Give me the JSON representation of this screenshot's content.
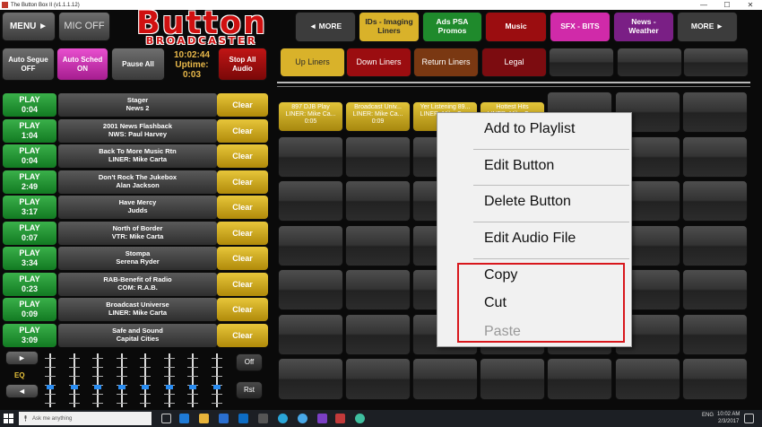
{
  "window": {
    "title": "The Button Box II (v1.1.1.12)",
    "controls": [
      "—",
      "☐",
      "✕"
    ]
  },
  "logo": {
    "line1": "Button",
    "line2": "BROADCASTER"
  },
  "top_left": {
    "menu_label": "MENU ►",
    "mic_label": "MIC OFF"
  },
  "controls": {
    "auto_segue": "Auto Segue\nOFF",
    "auto_sched": "Auto Sched\nON",
    "pause_all": "Pause All",
    "stop_all": "Stop All\nAudio"
  },
  "clock": {
    "time": "10:02:44",
    "uptime_label": "Uptime:",
    "uptime": "0:03"
  },
  "categories": [
    {
      "label": "◄ MORE",
      "color": "#3c3c3c",
      "text": "#ffffff"
    },
    {
      "label": "IDs - Imaging\nLiners",
      "color": "#d9b22a",
      "text": "#2a2a2a"
    },
    {
      "label": "Ads PSA\nPromos",
      "color": "#1f8a2c",
      "text": "#ffffff"
    },
    {
      "label": "Music",
      "color": "#9b0d10",
      "text": "#ffffff"
    },
    {
      "label": "SFX - BITS",
      "color": "#d02aa9",
      "text": "#ffffff"
    },
    {
      "label": "News -\nWeather",
      "color": "#7a1f85",
      "text": "#ffffff"
    },
    {
      "label": "MORE ►",
      "color": "#3c3c3c",
      "text": "#ffffff"
    }
  ],
  "subtabs": [
    {
      "label": "Up Liners",
      "color": "#d9b22a",
      "text": "#2a2a2a"
    },
    {
      "label": "Down Liners",
      "color": "#9b0d10",
      "text": "#ffffff"
    },
    {
      "label": "Return Liners",
      "color": "#7a3812",
      "text": "#ffffff"
    },
    {
      "label": "Legal",
      "color": "#7c0c10",
      "text": "#ffffff"
    }
  ],
  "playlist": [
    {
      "play": "PLAY",
      "time": "0:04",
      "line1": "Stager",
      "line2": "News 2",
      "clear": "Clear"
    },
    {
      "play": "PLAY",
      "time": "1:04",
      "line1": "2001 News Flashback",
      "line2": "NWS:  Paul Harvey",
      "clear": "Clear"
    },
    {
      "play": "PLAY",
      "time": "0:04",
      "line1": "Back To More Music Rtn",
      "line2": "LINER: Mike Carta",
      "clear": "Clear"
    },
    {
      "play": "PLAY",
      "time": "2:49",
      "line1": "Don't Rock The Jukebox",
      "line2": "Alan Jackson",
      "clear": "Clear"
    },
    {
      "play": "PLAY",
      "time": "3:17",
      "line1": "Have Mercy",
      "line2": "Judds",
      "clear": "Clear"
    },
    {
      "play": "PLAY",
      "time": "0:07",
      "line1": "North of Border",
      "line2": "VTR: Mike Carta",
      "clear": "Clear"
    },
    {
      "play": "PLAY",
      "time": "3:34",
      "line1": "Stompa",
      "line2": "Serena Ryder",
      "clear": "Clear"
    },
    {
      "play": "PLAY",
      "time": "0:23",
      "line1": "RAB-Benefit of Radio",
      "line2": "COM: R.A.B.",
      "clear": "Clear"
    },
    {
      "play": "PLAY",
      "time": "0:09",
      "line1": "Broadcast Universe",
      "line2": "LINER: Mike Carta",
      "clear": "Clear"
    },
    {
      "play": "PLAY",
      "time": "3:09",
      "line1": "Safe and Sound",
      "line2": "Capital Cities",
      "clear": "Clear"
    }
  ],
  "eq": {
    "next": "►",
    "label": "EQ",
    "prev": "◄",
    "off": "Off",
    "reset": "Rst"
  },
  "audio_buttons": [
    {
      "line1": "897 DJB Play",
      "line2": "LINER: Mike Ca...",
      "line3": "0:05"
    },
    {
      "line1": "Broadcast Univ...",
      "line2": "LINER: Mike Ca...",
      "line3": "0:09"
    },
    {
      "line1": "Yer Listening 89...",
      "line2": "LINER: Mike Ca...",
      "line3": ""
    },
    {
      "line1": "Hottest Hits",
      "line2": "LINER: Mike Ca...",
      "line3": ""
    }
  ],
  "context_menu": {
    "add": "Add to Playlist",
    "edit": "Edit Button",
    "delete": "Delete Button",
    "edit_audio": "Edit Audio File",
    "copy": "Copy",
    "cut": "Cut",
    "paste": "Paste"
  },
  "taskbar": {
    "search_placeholder": "Ask me anything",
    "lang": "ENG",
    "time": "10:02 AM",
    "date": "2/3/2017"
  }
}
